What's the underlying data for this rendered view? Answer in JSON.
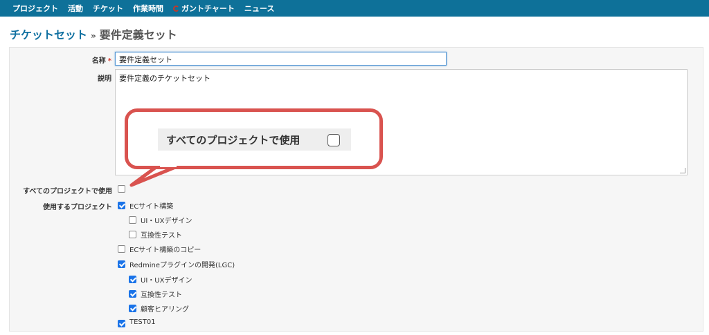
{
  "menu": {
    "items": [
      "プロジェクト",
      "活動",
      "チケット",
      "作業時間",
      "ガントチャート",
      "ニュース"
    ],
    "gantt_icon": "gantt-icon"
  },
  "breadcrumb": {
    "parent": "チケットセット",
    "separator": "»",
    "current": "要件定義セット"
  },
  "form": {
    "name_label": "名称",
    "required_mark": "*",
    "name_value": "要件定義セット",
    "description_label": "説明",
    "description_value": "要件定義のチケットセット",
    "all_projects_label": "すべてのプロジェクトで使用",
    "all_projects_checked": false,
    "projects_label": "使用するプロジェクト",
    "projects": [
      {
        "name": "ECサイト構築",
        "checked": true
      },
      {
        "name": "UI・UXデザイン",
        "checked": false
      },
      {
        "name": "互換性テスト",
        "checked": false
      },
      {
        "name": "ECサイト構築のコピー",
        "checked": false
      },
      {
        "name": "Redmineプラグインの開発(LGC)",
        "checked": true
      },
      {
        "name": "UI・UXデザイン",
        "checked": true
      },
      {
        "name": "互換性テスト",
        "checked": true
      },
      {
        "name": "顧客ヒアリング",
        "checked": true
      },
      {
        "name": "TEST01",
        "checked": true
      }
    ]
  },
  "callout": {
    "text": "すべてのプロジェクトで使用",
    "checked": false,
    "border_color": "#d9534f"
  },
  "colors": {
    "topbar": "#0e7199",
    "link": "#0e6fa0",
    "checkbox_checked": "#1a73e8"
  }
}
